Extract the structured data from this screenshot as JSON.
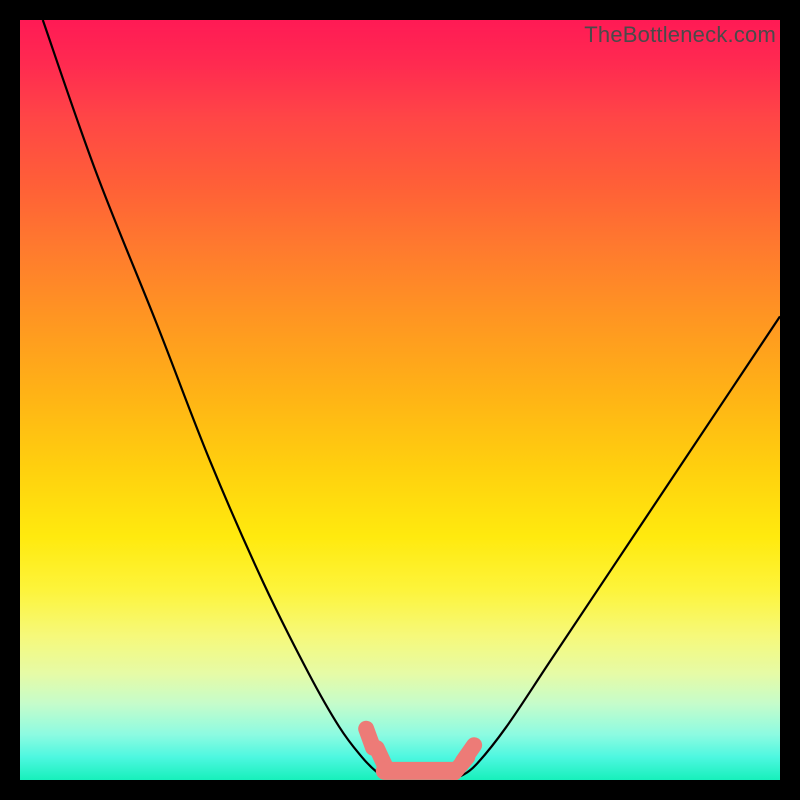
{
  "watermark": "TheBottleneck.com",
  "chart_data": {
    "type": "line",
    "title": "",
    "xlabel": "",
    "ylabel": "",
    "xlim": [
      0,
      100
    ],
    "ylim": [
      0,
      100
    ],
    "series": [
      {
        "name": "left-curve",
        "x": [
          3,
          10,
          18,
          25,
          32,
          38,
          42,
          45,
          47,
          48
        ],
        "y": [
          100,
          80,
          60,
          42,
          26,
          14,
          7,
          3,
          1,
          0.5
        ]
      },
      {
        "name": "right-curve",
        "x": [
          58,
          60,
          64,
          70,
          78,
          86,
          94,
          100
        ],
        "y": [
          0.5,
          2,
          7,
          16,
          28,
          40,
          52,
          61
        ]
      }
    ],
    "markers": [
      {
        "name": "left-dot-upper",
        "x": 46,
        "y": 5.5
      },
      {
        "name": "left-dot-lower",
        "x": 47.5,
        "y": 3.0
      },
      {
        "name": "bottom-flat",
        "x_start": 48,
        "x_end": 57,
        "y": 1.2
      },
      {
        "name": "right-dot-upper",
        "x": 59,
        "y": 3.5
      },
      {
        "name": "right-dot-lower",
        "x": 58,
        "y": 2.0
      }
    ],
    "colors": {
      "curve": "#000000",
      "marker": "#ed7b77",
      "background_top": "#ff1a55",
      "background_bottom": "#17f0bb"
    }
  }
}
